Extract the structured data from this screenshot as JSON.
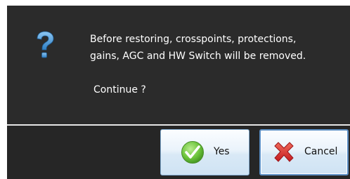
{
  "dialog": {
    "icon": "question-icon",
    "message_lines": [
      "Before restoring, crosspoints, protections,",
      "gains, AGC and HW Switch will be removed.",
      "Continue ?"
    ]
  },
  "buttons": {
    "yes": {
      "label": "Yes",
      "icon": "checkmark-icon"
    },
    "cancel": {
      "label": "Cancel",
      "icon": "red-x-icon"
    }
  },
  "colors": {
    "background": "#2b2b2b",
    "text": "#ffffff",
    "question_icon": "#4a9ad8",
    "button_border_focus": "#5c8fc4",
    "checkmark": "#5cb82e",
    "cancel_x": "#d8262b"
  }
}
